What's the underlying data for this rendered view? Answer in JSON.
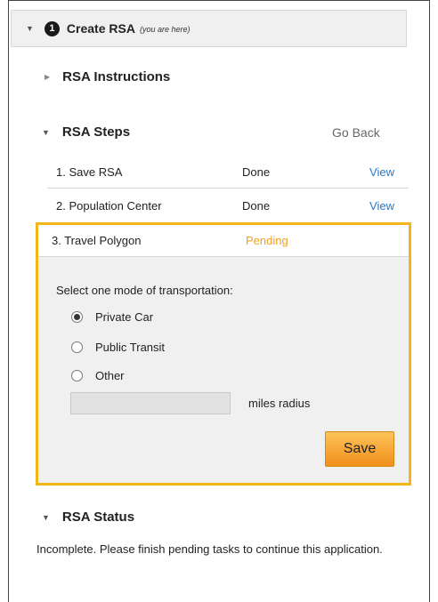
{
  "header": {
    "step_number": "1",
    "title": "Create RSA",
    "subtitle": "(you are here)"
  },
  "instructions": {
    "label": "RSA Instructions"
  },
  "steps": {
    "label": "RSA Steps",
    "go_back": "Go Back",
    "rows": [
      {
        "name": "1. Save RSA",
        "status": "Done",
        "link": "View"
      },
      {
        "name": "2. Population Center",
        "status": "Done",
        "link": "View"
      },
      {
        "name": "3. Travel Polygon",
        "status": "Pending"
      }
    ]
  },
  "transport": {
    "prompt": "Select one mode of transportation:",
    "options": [
      {
        "label": "Private Car",
        "selected": true
      },
      {
        "label": "Public Transit",
        "selected": false
      },
      {
        "label": "Other",
        "selected": false
      }
    ],
    "miles_value": "",
    "miles_label": "miles radius",
    "save_label": "Save"
  },
  "status": {
    "label": "RSA Status",
    "text": "Incomplete. Please finish pending tasks to continue this application."
  },
  "colors": {
    "pending": "#f0a020",
    "link": "#2a78c6",
    "highlight_border": "#f2b61a",
    "save_button": "#f5a230"
  }
}
